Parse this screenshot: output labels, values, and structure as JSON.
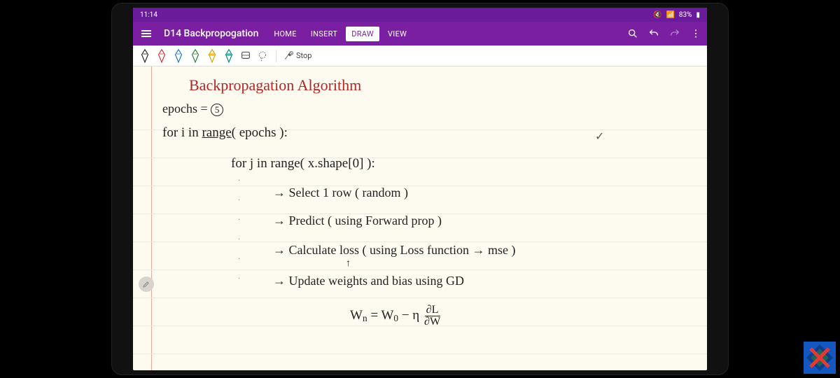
{
  "status": {
    "time": "11:14",
    "battery": "83%"
  },
  "header": {
    "title": "D14 Backpropogation",
    "tabs": {
      "home": "HOME",
      "insert": "INSERT",
      "draw": "DRAW",
      "view": "VIEW"
    }
  },
  "toolbar": {
    "stop_label": "Stop"
  },
  "pen_colors": [
    "#222",
    "#d32f2f",
    "#1976d2",
    "#2e7d32",
    "#fbc02d",
    "#00897b",
    "#616161"
  ],
  "handwriting": {
    "title": "Backpropagation Algorithm",
    "l1a": "epochs = ",
    "l1b": "5",
    "l2": "for i in range( epochs ):",
    "l3": "for j in range( x.shape[0] ):",
    "b1": "Select 1 row ( random )",
    "b2": "Predict ( using Forward prop )",
    "b3": "Calculate loss ( using Loss function → mse )",
    "b3note": "↑",
    "b4": "Update weights and bias using GD",
    "formula": {
      "lhs": "W",
      "n": "n",
      "eq": " = W",
      "z": "0",
      "minus": " − η ",
      "dtop": "∂L",
      "dbot": "∂W"
    }
  }
}
